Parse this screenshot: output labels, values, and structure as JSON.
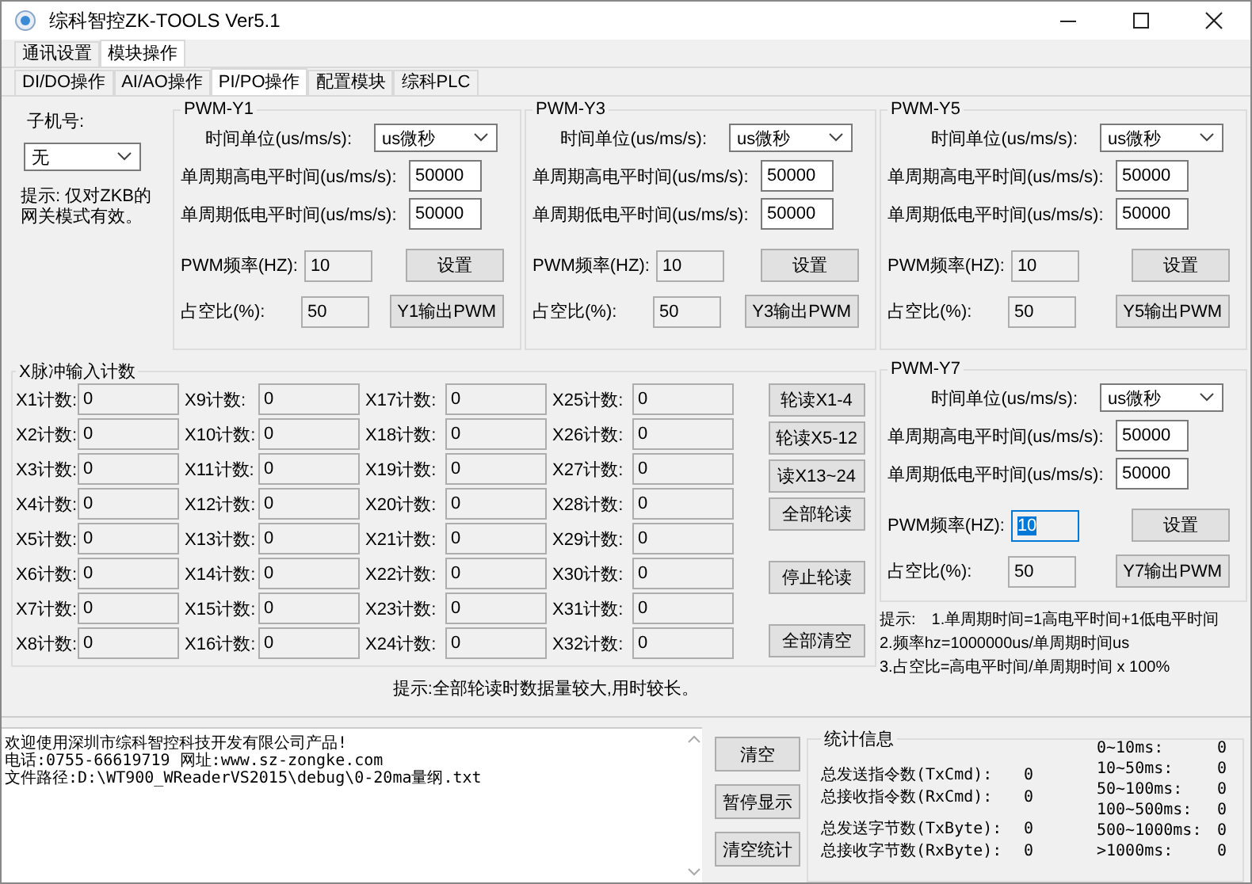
{
  "window": {
    "title": "综科智控ZK-TOOLS Ver5.1"
  },
  "tabs": [
    {
      "label": "通讯设置",
      "selected": false
    },
    {
      "label": "模块操作",
      "selected": true
    }
  ],
  "subtabs": [
    {
      "label": "DI/DO操作",
      "selected": false
    },
    {
      "label": "AI/AO操作",
      "selected": false
    },
    {
      "label": "PI/PO操作",
      "selected": true
    },
    {
      "label": "配置模块",
      "selected": false
    },
    {
      "label": "综科PLC",
      "selected": false
    }
  ],
  "slave": {
    "label": "子机号:",
    "value": "无",
    "hint": "提示: 仅对ZKB的网关模式有效。"
  },
  "pwm_groups": [
    {
      "title": "PWM-Y1",
      "unit_label": "时间单位(us/ms/s):",
      "unit_value": "us微秒",
      "high_label": "单周期高电平时间(us/ms/s):",
      "high_value": "50000",
      "low_label": "单周期低电平时间(us/ms/s):",
      "low_value": "50000",
      "freq_label": "PWM频率(HZ):",
      "freq_value": "10",
      "freq_focused": false,
      "duty_label": "占空比(%):",
      "duty_value": "50",
      "set_button": "设置",
      "output_button": "Y1输出PWM"
    },
    {
      "title": "PWM-Y3",
      "unit_label": "时间单位(us/ms/s):",
      "unit_value": "us微秒",
      "high_label": "单周期高电平时间(us/ms/s):",
      "high_value": "50000",
      "low_label": "单周期低电平时间(us/ms/s):",
      "low_value": "50000",
      "freq_label": "PWM频率(HZ):",
      "freq_value": "10",
      "freq_focused": false,
      "duty_label": "占空比(%):",
      "duty_value": "50",
      "set_button": "设置",
      "output_button": "Y3输出PWM"
    },
    {
      "title": "PWM-Y5",
      "unit_label": "时间单位(us/ms/s):",
      "unit_value": "us微秒",
      "high_label": "单周期高电平时间(us/ms/s):",
      "high_value": "50000",
      "low_label": "单周期低电平时间(us/ms/s):",
      "low_value": "50000",
      "freq_label": "PWM频率(HZ):",
      "freq_value": "10",
      "freq_focused": false,
      "duty_label": "占空比(%):",
      "duty_value": "50",
      "set_button": "设置",
      "output_button": "Y5输出PWM"
    },
    {
      "title": "PWM-Y7",
      "unit_label": "时间单位(us/ms/s):",
      "unit_value": "us微秒",
      "high_label": "单周期高电平时间(us/ms/s):",
      "high_value": "50000",
      "low_label": "单周期低电平时间(us/ms/s):",
      "low_value": "50000",
      "freq_label": "PWM频率(HZ):",
      "freq_value": "10",
      "freq_focused": true,
      "duty_label": "占空比(%):",
      "duty_value": "50",
      "set_button": "设置",
      "output_button": "Y7输出PWM"
    }
  ],
  "pulse_counter": {
    "title": "X脉冲输入计数",
    "counters": [
      {
        "label": "X1计数:",
        "value": "0"
      },
      {
        "label": "X2计数:",
        "value": "0"
      },
      {
        "label": "X3计数:",
        "value": "0"
      },
      {
        "label": "X4计数:",
        "value": "0"
      },
      {
        "label": "X5计数:",
        "value": "0"
      },
      {
        "label": "X6计数:",
        "value": "0"
      },
      {
        "label": "X7计数:",
        "value": "0"
      },
      {
        "label": "X8计数:",
        "value": "0"
      },
      {
        "label": "X9计数:",
        "value": "0"
      },
      {
        "label": "X10计数:",
        "value": "0"
      },
      {
        "label": "X11计数:",
        "value": "0"
      },
      {
        "label": "X12计数:",
        "value": "0"
      },
      {
        "label": "X13计数:",
        "value": "0"
      },
      {
        "label": "X14计数:",
        "value": "0"
      },
      {
        "label": "X15计数:",
        "value": "0"
      },
      {
        "label": "X16计数:",
        "value": "0"
      },
      {
        "label": "X17计数:",
        "value": "0"
      },
      {
        "label": "X18计数:",
        "value": "0"
      },
      {
        "label": "X19计数:",
        "value": "0"
      },
      {
        "label": "X20计数:",
        "value": "0"
      },
      {
        "label": "X21计数:",
        "value": "0"
      },
      {
        "label": "X22计数:",
        "value": "0"
      },
      {
        "label": "X23计数:",
        "value": "0"
      },
      {
        "label": "X24计数:",
        "value": "0"
      },
      {
        "label": "X25计数:",
        "value": "0"
      },
      {
        "label": "X26计数:",
        "value": "0"
      },
      {
        "label": "X27计数:",
        "value": "0"
      },
      {
        "label": "X28计数:",
        "value": "0"
      },
      {
        "label": "X29计数:",
        "value": "0"
      },
      {
        "label": "X30计数:",
        "value": "0"
      },
      {
        "label": "X31计数:",
        "value": "0"
      },
      {
        "label": "X32计数:",
        "value": "0"
      }
    ],
    "buttons": [
      {
        "label": "轮读X1-4",
        "kind": "group"
      },
      {
        "label": "轮读X5-12",
        "kind": "group"
      },
      {
        "label": "读X13~24",
        "kind": "group"
      },
      {
        "label": "全部轮读",
        "kind": "group"
      },
      {
        "label": "停止轮读",
        "kind": "solo"
      },
      {
        "label": "全部清空",
        "kind": "solo"
      }
    ],
    "hint": "提示:全部轮读时数据量较大,用时较长。"
  },
  "pwm_hints": {
    "title": "提示:",
    "lines": [
      "1.单周期时间=1高电平时间+1低电平时间",
      "2.频率hz=1000000us/单周期时间us",
      "3.占空比=高电平时间/单周期时间 x 100%"
    ]
  },
  "log": {
    "lines": [
      "欢迎使用深圳市综科智控科技开发有限公司产品!",
      "电话:0755-66619719 网址:www.sz-zongke.com",
      "文件路径:D:\\WT900_WReaderVS2015\\debug\\0-20ma量纲.txt"
    ]
  },
  "log_buttons": [
    "清空",
    "暂停显示",
    "清空统计"
  ],
  "stats": {
    "title": "统计信息",
    "counters": [
      {
        "label": "总发送指令数(TxCmd):",
        "value": "0"
      },
      {
        "label": "总接收指令数(RxCmd):",
        "value": "0"
      },
      {
        "label": "总发送字节数(TxByte):",
        "value": "0"
      },
      {
        "label": "总接收字节数(RxByte):",
        "value": "0"
      }
    ],
    "latency": [
      {
        "label": "0~10ms:",
        "value": "0"
      },
      {
        "label": "10~50ms:",
        "value": "0"
      },
      {
        "label": "50~100ms:",
        "value": "0"
      },
      {
        "label": "100~500ms:",
        "value": "0"
      },
      {
        "label": "500~1000ms:",
        "value": "0"
      },
      {
        "label": ">1000ms:",
        "value": "0"
      }
    ]
  }
}
